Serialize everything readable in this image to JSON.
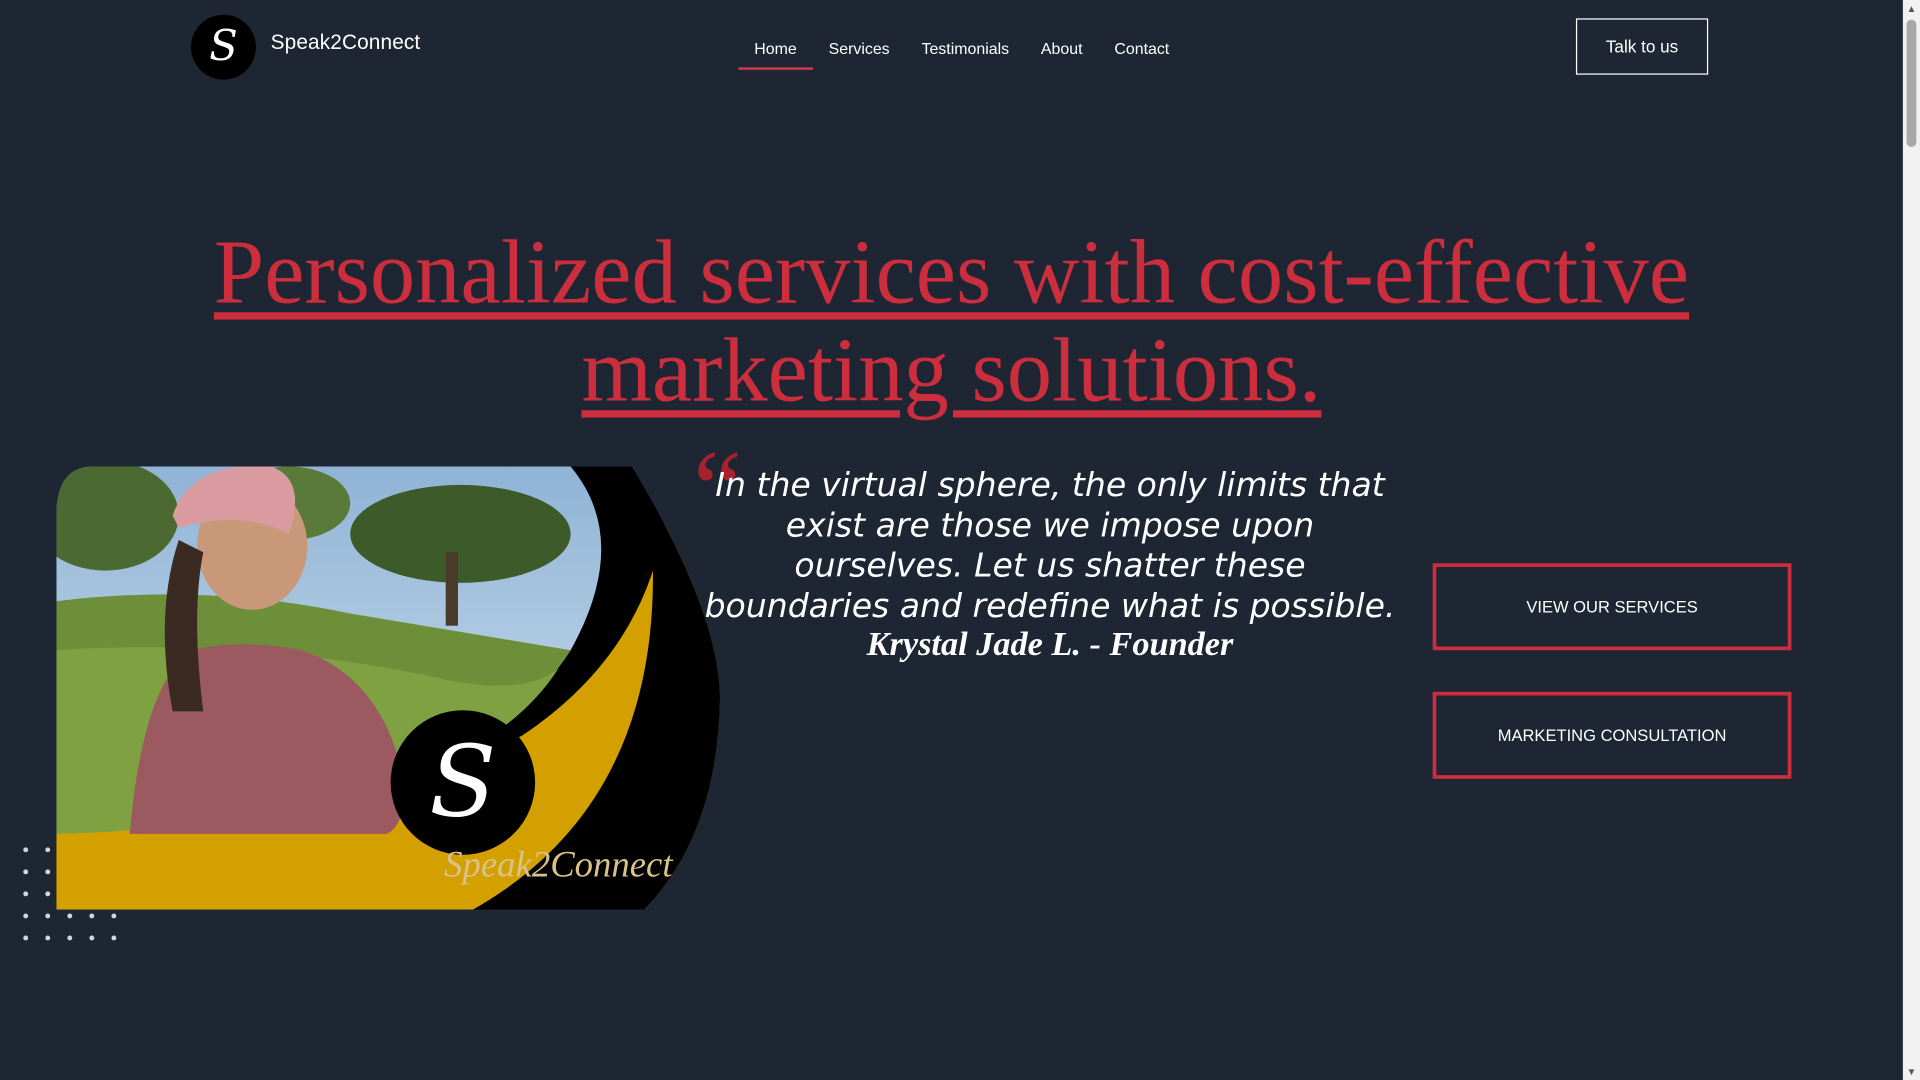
{
  "header": {
    "brand": "Speak2Connect",
    "logo_glyph": "S",
    "nav": [
      {
        "label": "Home",
        "active": true
      },
      {
        "label": "Services",
        "active": false
      },
      {
        "label": "Testimonials",
        "active": false
      },
      {
        "label": "About",
        "active": false
      },
      {
        "label": "Contact",
        "active": false
      }
    ],
    "cta_label": "Talk to us"
  },
  "hero": {
    "headline_line1": "Personalized services with cost-effective",
    "headline_line2": "marketing solutions.",
    "quote_mark": "“",
    "quote": "In the virtual sphere, the only limits that exist are those we impose upon ourselves. Let us shatter these boundaries and redefine what is possible.",
    "author": "Krystal Jade L. - Founder",
    "image_logo_text": "Speak2Connect",
    "buttons": {
      "services": "VIEW OUR SERVICES",
      "consultation": "MARKETING CONSULTATION"
    }
  },
  "colors": {
    "background": "#1e2633",
    "accent": "#cc2e3e",
    "gold": "#d4a000"
  },
  "icons": {
    "quote": "quote-icon",
    "logo": "logo-icon"
  }
}
